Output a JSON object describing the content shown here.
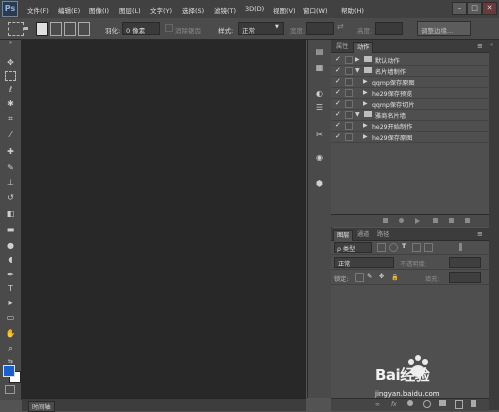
{
  "app": {
    "logo": "Ps"
  },
  "menu": [
    "文件(F)",
    "编辑(E)",
    "图像(I)",
    "图层(L)",
    "文字(Y)",
    "选择(S)",
    "滤镜(T)",
    "3D(D)",
    "视图(V)",
    "窗口(W)",
    "帮助(H)"
  ],
  "window_buttons": {
    "minimize": "–",
    "maximize": "□",
    "close": "✕"
  },
  "options": {
    "feather_label": "羽化:",
    "feather_value": "0 像素",
    "antialias_label": "消除锯齿",
    "style_label": "样式:",
    "style_value": "正常",
    "width_label": "宽度:",
    "height_label": "高度:",
    "refine_edge_button": "调整边缘..."
  },
  "canvas": {
    "bottom_tab": "时间轴"
  },
  "actions_panel": {
    "tabs": [
      {
        "label": "属性",
        "active": false
      },
      {
        "label": "动作",
        "active": true
      }
    ],
    "rows": [
      {
        "check": "✓",
        "expand": "▶",
        "folder": true,
        "label": "默认动作",
        "indent": 0
      },
      {
        "check": "✓",
        "expand": "▼",
        "folder": true,
        "label": "名片墙制作",
        "indent": 0
      },
      {
        "check": "✓",
        "expand": "▶",
        "folder": false,
        "label": "qqmp保存原图",
        "indent": 1
      },
      {
        "check": "✓",
        "expand": "▶",
        "folder": false,
        "label": "he29保存预览",
        "indent": 1
      },
      {
        "check": "✓",
        "expand": "▶",
        "folder": false,
        "label": "qqmp保存切片",
        "indent": 1
      },
      {
        "check": "✓",
        "expand": "▼",
        "folder": true,
        "label": "雅商名片墙",
        "indent": 0
      },
      {
        "check": "✓",
        "expand": "▶",
        "folder": false,
        "label": "he29开始制作",
        "indent": 1
      },
      {
        "check": "✓",
        "expand": "▶",
        "folder": false,
        "label": "he29保存原图",
        "indent": 1
      }
    ]
  },
  "layers_panel": {
    "tabs": [
      {
        "label": "图层",
        "active": true
      },
      {
        "label": "通道",
        "active": false
      },
      {
        "label": "路径",
        "active": false
      }
    ],
    "filter_label": "ρ 类型",
    "blend_mode": "正常",
    "opacity_label": "不透明度:",
    "lock_label": "锁定:",
    "fill_label": "填充:"
  },
  "watermark": {
    "brand": "Bai经验",
    "url": "jingyan.baidu.com"
  },
  "colors": {
    "foreground": "#1a5fd0",
    "background": "#ffffff",
    "accent": "#2c8fd6"
  }
}
